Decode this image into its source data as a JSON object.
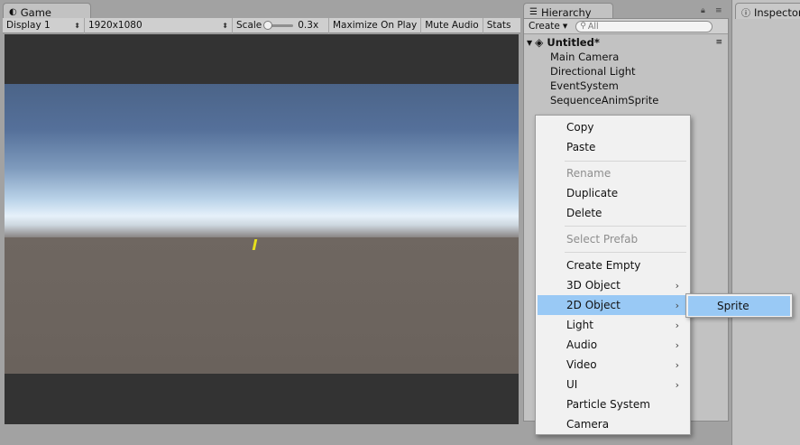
{
  "game": {
    "tab_label": "Game",
    "display": "Display 1",
    "resolution": "1920x1080",
    "scale_label": "Scale",
    "scale_value": "0.3x",
    "maximize": "Maximize On Play",
    "mute": "Mute Audio",
    "stats": "Stats"
  },
  "hierarchy": {
    "tab_label": "Hierarchy",
    "create": "Create",
    "search_placeholder": "All",
    "scene": "Untitled*",
    "items": [
      "Main Camera",
      "Directional Light",
      "EventSystem",
      "SequenceAnimSprite"
    ]
  },
  "inspector": {
    "tab_label": "Inspector"
  },
  "context_menu": {
    "items": [
      {
        "label": "Copy",
        "enabled": true
      },
      {
        "label": "Paste",
        "enabled": true
      },
      {
        "label": "Rename",
        "enabled": false
      },
      {
        "label": "Duplicate",
        "enabled": true
      },
      {
        "label": "Delete",
        "enabled": true
      },
      {
        "label": "Select Prefab",
        "enabled": false
      },
      {
        "label": "Create Empty",
        "enabled": true
      },
      {
        "label": "3D Object",
        "enabled": true
      },
      {
        "label": "2D Object",
        "enabled": true
      },
      {
        "label": "Light",
        "enabled": true
      },
      {
        "label": "Audio",
        "enabled": true
      },
      {
        "label": "Video",
        "enabled": true
      },
      {
        "label": "UI",
        "enabled": true
      },
      {
        "label": "Particle System",
        "enabled": true
      },
      {
        "label": "Camera",
        "enabled": true
      }
    ],
    "submenu_arrow": "›"
  },
  "sub_menu": {
    "items": [
      "Sprite"
    ]
  },
  "colors": {
    "highlight": "#99c9f5",
    "sprite": "#e6e01c"
  }
}
